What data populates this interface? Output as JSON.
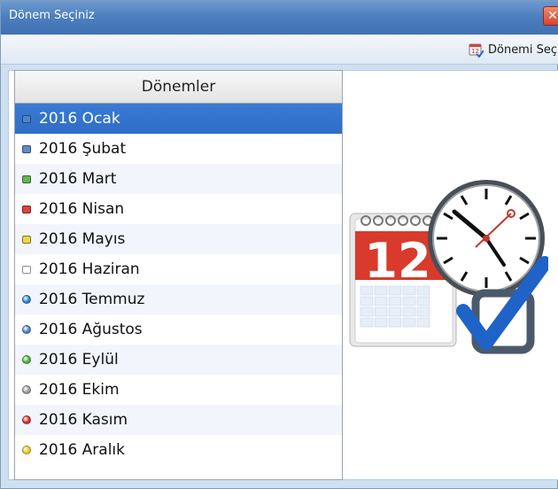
{
  "window": {
    "title": "Dönem Seçiniz",
    "close_glyph": "✕"
  },
  "toolbar": {
    "select_label": "Dönemi Seç",
    "select_icon": "calendar-select-icon"
  },
  "list": {
    "header": "Dönemler",
    "selected_index": 0,
    "items": [
      {
        "label": "2016 Ocak",
        "shape": "square",
        "color": "#4f86c9"
      },
      {
        "label": "2016 Şubat",
        "shape": "square",
        "color": "#5a8cc7"
      },
      {
        "label": "2016 Mart",
        "shape": "square",
        "color": "#63b84f"
      },
      {
        "label": "2016 Nisan",
        "shape": "square",
        "color": "#d9443b"
      },
      {
        "label": "2016 Mayıs",
        "shape": "square",
        "color": "#f0d54a"
      },
      {
        "label": "2016 Haziran",
        "shape": "square",
        "color": "#ffffff"
      },
      {
        "label": "2016 Temmuz",
        "shape": "dot",
        "color": "#2a7fd4"
      },
      {
        "label": "2016 Ağustos",
        "shape": "dot",
        "color": "#4b7fc4"
      },
      {
        "label": "2016 Eylül",
        "shape": "dot",
        "color": "#4cae3d"
      },
      {
        "label": "2016 Ekim",
        "shape": "dot",
        "color": "#9a9a9a"
      },
      {
        "label": "2016 Kasım",
        "shape": "dot",
        "color": "#d12c2c"
      },
      {
        "label": "2016 Aralık",
        "shape": "dot",
        "color": "#f2c21a"
      }
    ]
  },
  "illustration": {
    "calendar_day": "12"
  },
  "colors": {
    "titlebar": "#4e7fbf",
    "selection": "#3272cc"
  }
}
